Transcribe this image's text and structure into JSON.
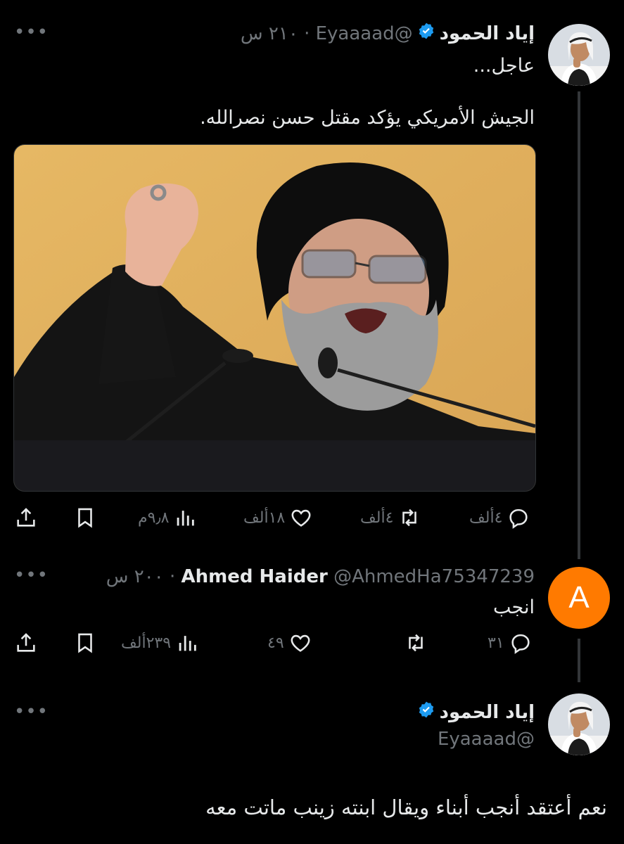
{
  "tweet1": {
    "name": "إياد الحمود",
    "handle": "@Eyaaaad",
    "time": "٢١٠ س",
    "line1": "عاجل...",
    "line2": "الجيش الأمريكي يؤكد مقتل حسن نصرالله.",
    "actions": {
      "replies": "٤ألف",
      "retweets": "٤ألف",
      "likes": "١٨ألف",
      "views": "٩٫٨م"
    }
  },
  "tweet2": {
    "name": "Ahmed Haider",
    "handle": "@AhmedHa75347239",
    "time": "٢٠٠ س",
    "avatar_letter": "A",
    "text": "انجب",
    "actions": {
      "replies": "٣١",
      "retweets": "",
      "likes": "٤٩",
      "views": "٢٣٩ألف"
    }
  },
  "tweet3": {
    "name": "إياد الحمود",
    "handle": "@Eyaaaad",
    "text": "نعم أعتقد أنجب أبناء ويقال ابنته زينب ماتت معه"
  },
  "colors": {
    "background": "#000000",
    "text": "#e7e9ea",
    "muted": "#71767b",
    "verified": "#1d9bf0",
    "avatar_orange": "#ff7a00",
    "media_backdrop": "#e2b35f"
  },
  "icons": [
    "more-icon",
    "verified-icon",
    "reply-icon",
    "retweet-icon",
    "like-icon",
    "views-icon",
    "bookmark-icon",
    "share-icon"
  ]
}
